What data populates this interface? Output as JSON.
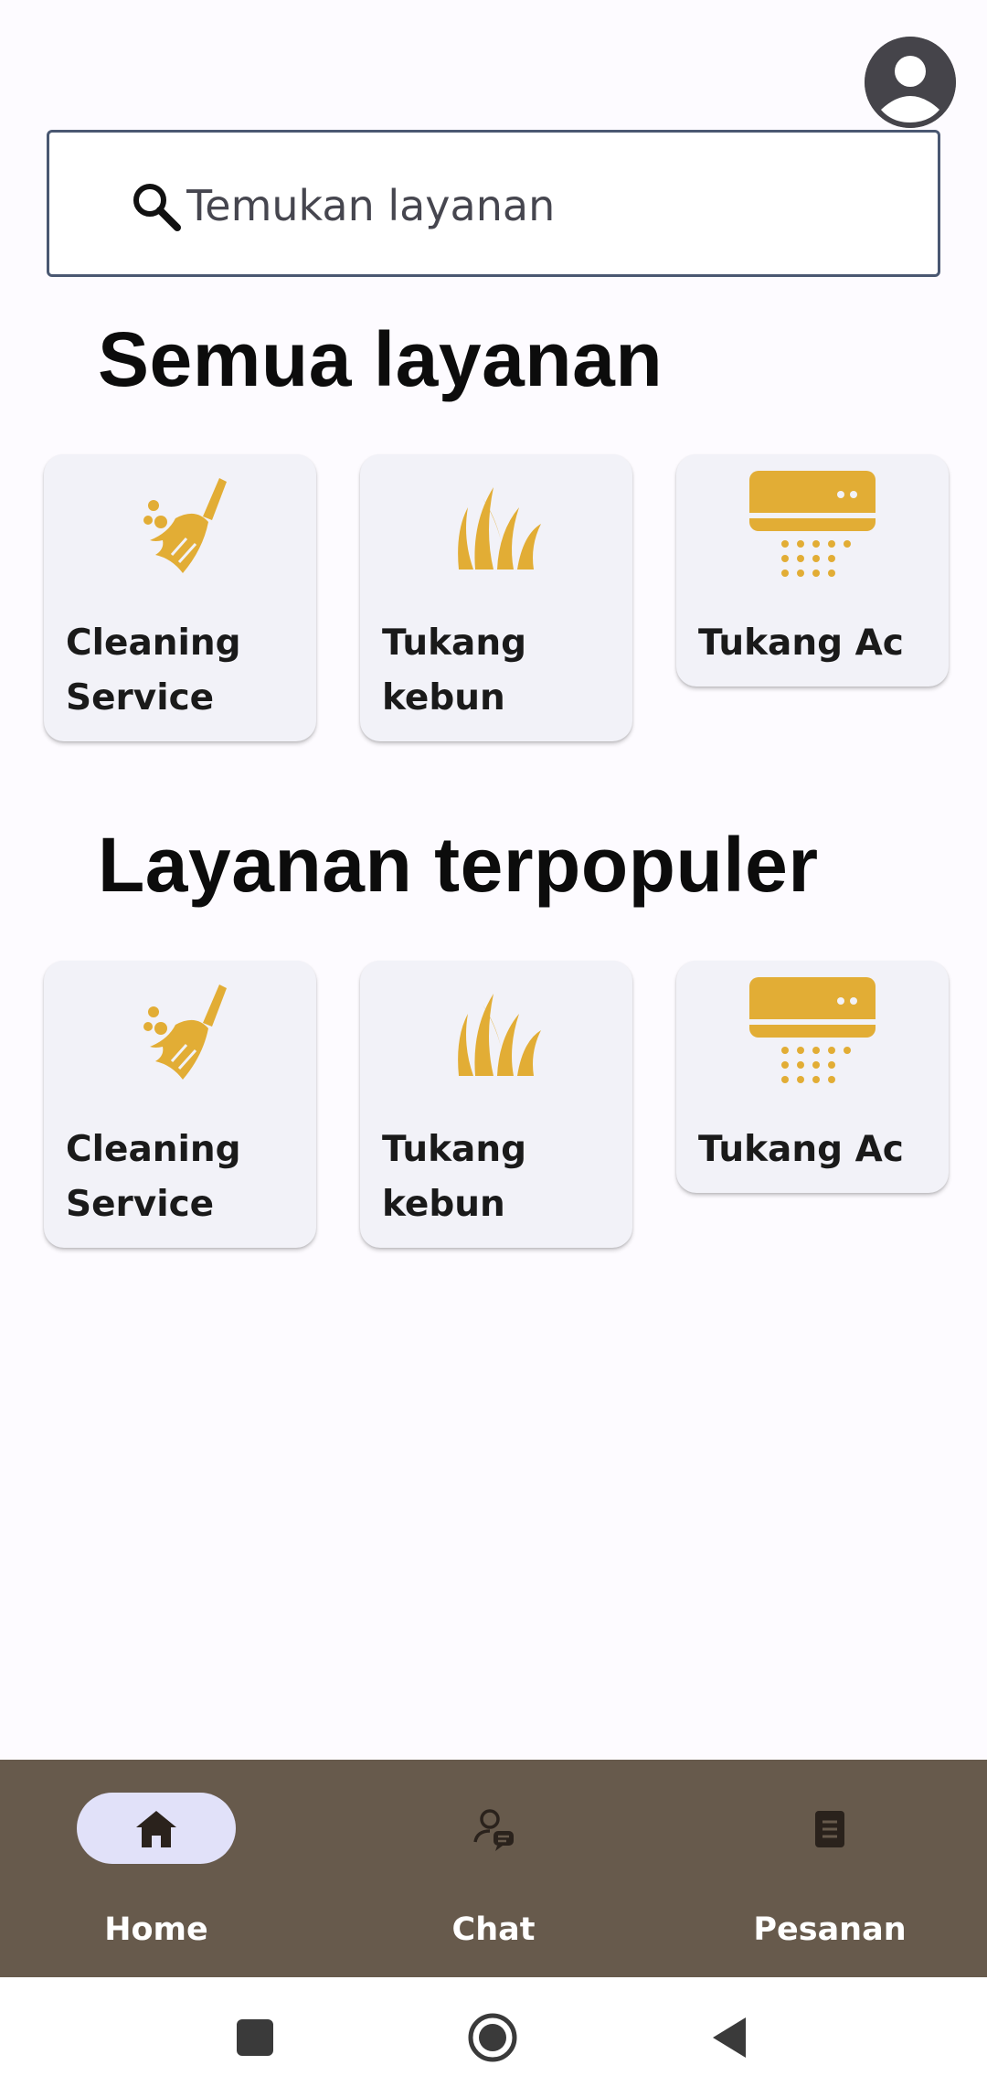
{
  "header": {
    "avatar_icon": "account-circle-icon"
  },
  "search": {
    "icon": "search-icon",
    "placeholder": "Temukan layanan",
    "value": ""
  },
  "sections": [
    {
      "title": "Semua layanan",
      "cards": [
        {
          "label": "Cleaning Service",
          "icon": "broom-icon"
        },
        {
          "label": "Tukang kebun",
          "icon": "grass-icon"
        },
        {
          "label": "Tukang Ac",
          "icon": "air-conditioner-icon"
        }
      ]
    },
    {
      "title": "Layanan terpopuler",
      "cards": [
        {
          "label": "Cleaning Service",
          "icon": "broom-icon"
        },
        {
          "label": "Tukang kebun",
          "icon": "grass-icon"
        },
        {
          "label": "Tukang Ac",
          "icon": "air-conditioner-icon"
        }
      ]
    }
  ],
  "bottom_nav": {
    "items": [
      {
        "label": "Home",
        "icon": "home-icon",
        "active": true
      },
      {
        "label": "Chat",
        "icon": "chat-person-icon",
        "active": false
      },
      {
        "label": "Pesanan",
        "icon": "receipt-icon",
        "active": false
      }
    ]
  },
  "system_nav": {
    "buttons": [
      "recents-square-icon",
      "home-circle-icon",
      "back-triangle-icon"
    ]
  },
  "colors": {
    "accent_icon": "#e2ad35",
    "nav_background": "#675a4c",
    "nav_active_pill": "#e1e1f9",
    "card_background": "#f2f2f8",
    "page_background": "#fdfbff"
  }
}
